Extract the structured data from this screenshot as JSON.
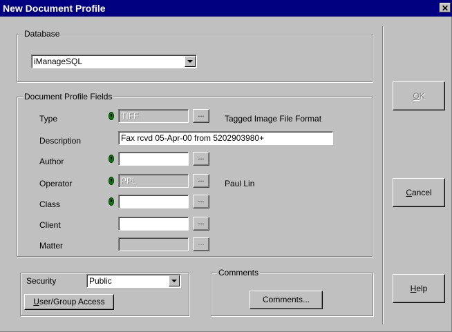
{
  "window": {
    "title": "New Document Profile",
    "close_glyph": "✕"
  },
  "database": {
    "group_label": "Database",
    "selected": "iManageSQL"
  },
  "profile": {
    "group_label": "Document Profile Fields",
    "rows": [
      {
        "label": "Type",
        "value": "TIFF",
        "required": true,
        "disabled": true,
        "browse": "...",
        "extra": "Tagged Image File Format"
      },
      {
        "label": "Description",
        "value": "Fax rcvd 05-Apr-00 from 5202903980+",
        "required": false
      },
      {
        "label": "Author",
        "value": "",
        "required": true,
        "browse": "..."
      },
      {
        "label": "Operator",
        "value": "PPL",
        "required": true,
        "disabled": true,
        "browse": "...",
        "extra": "Paul Lin"
      },
      {
        "label": "Class",
        "value": "",
        "required": true,
        "browse": "..."
      },
      {
        "label": "Client",
        "value": "",
        "required": false,
        "browse": "..."
      },
      {
        "label": "Matter",
        "value": "",
        "required": false,
        "disabled": true,
        "browse": "..."
      }
    ]
  },
  "security": {
    "label": "Security",
    "selected": "Public",
    "access_button_first": "U",
    "access_button_rest": "ser/Group Access"
  },
  "comments": {
    "group_label": "Comments",
    "button": "Comments..."
  },
  "buttons": {
    "ok_first": "O",
    "ok_rest": "K",
    "cancel_first": "C",
    "cancel_rest": "ancel",
    "help_first": "H",
    "help_rest": "elp"
  },
  "icons": {
    "required": "required-field-icon",
    "dropdown": "chevron-down-icon"
  }
}
